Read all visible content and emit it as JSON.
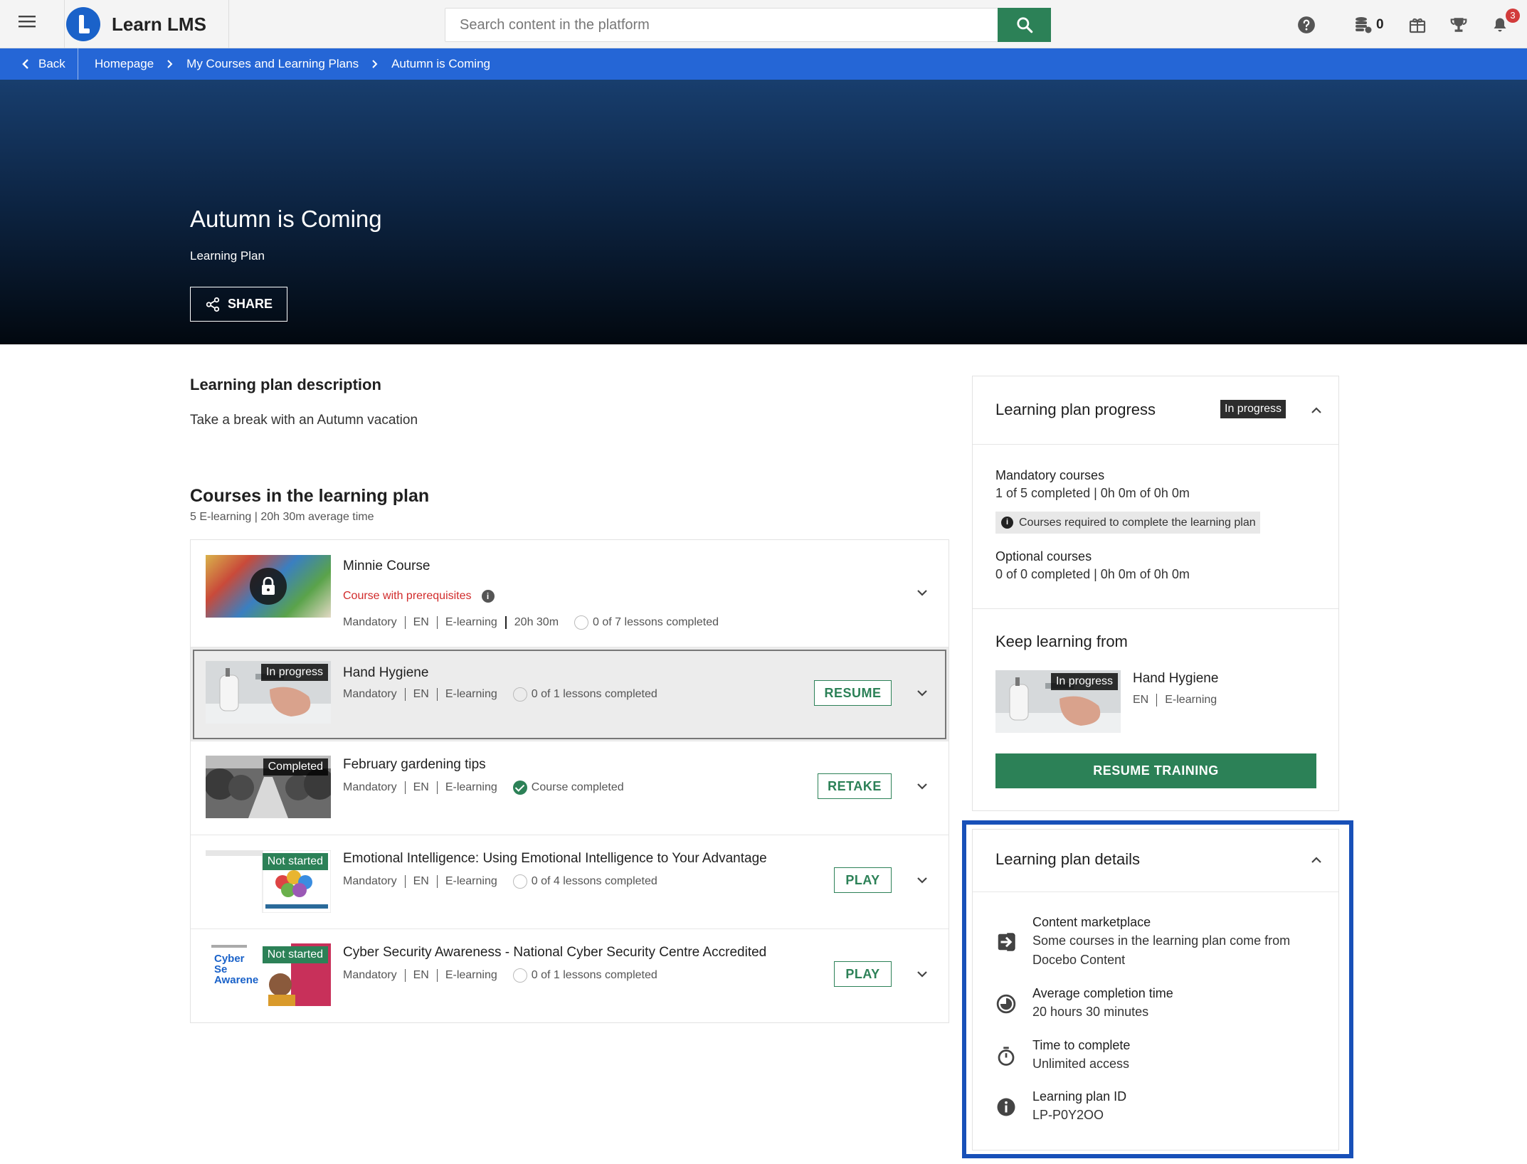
{
  "app": {
    "name": "Learn LMS",
    "search_placeholder": "Search content in the platform",
    "coins": "0",
    "notifications": "3"
  },
  "breadcrumb": {
    "back": "Back",
    "items": [
      "Homepage",
      "My Courses and Learning Plans",
      "Autumn is Coming"
    ]
  },
  "hero": {
    "title": "Autumn is Coming",
    "subtitle": "Learning Plan",
    "share": "SHARE"
  },
  "description": {
    "title": "Learning plan description",
    "text": "Take a break with an Autumn vacation"
  },
  "courses": {
    "title": "Courses in the learning plan",
    "subtitle": "5 E-learning | 20h 30m average time",
    "items": [
      {
        "name": "Minnie Course",
        "prereq": "Course with prerequisites",
        "type": "Mandatory",
        "lang": "EN",
        "format": "E-learning",
        "duration": "20h 30m",
        "progress": "0 of 7 lessons completed"
      },
      {
        "name": "Hand Hygiene",
        "badge": "In progress",
        "type": "Mandatory",
        "lang": "EN",
        "format": "E-learning",
        "progress": "0 of 1 lessons completed",
        "action": "RESUME"
      },
      {
        "name": "February gardening tips",
        "badge": "Completed",
        "type": "Mandatory",
        "lang": "EN",
        "format": "E-learning",
        "progress": "Course completed",
        "action": "RETAKE"
      },
      {
        "name": "Emotional Intelligence: Using Emotional Intelligence to Your Advantage",
        "badge": "Not started",
        "type": "Mandatory",
        "lang": "EN",
        "format": "E-learning",
        "progress": "0 of 4 lessons completed",
        "action": "PLAY"
      },
      {
        "name": "Cyber Security Awareness - National Cyber Security Centre Accredited",
        "badge": "Not started",
        "thumb_text": "Cyber Se Awarene",
        "type": "Mandatory",
        "lang": "EN",
        "format": "E-learning",
        "progress": "0 of 1 lessons completed",
        "action": "PLAY"
      }
    ]
  },
  "progress_panel": {
    "title": "Learning plan progress",
    "status": "In progress",
    "mandatory_label": "Mandatory courses",
    "mandatory_value": "1 of 5 completed | 0h 0m of 0h 0m",
    "required_note": "Courses required to complete the learning plan",
    "optional_label": "Optional courses",
    "optional_value": "0 of 0 completed | 0h 0m of 0h 0m",
    "keep_learning_title": "Keep learning from",
    "keep_course": "Hand Hygiene",
    "keep_badge": "In progress",
    "keep_lang": "EN",
    "keep_format": "E-learning",
    "resume_button": "RESUME TRAINING"
  },
  "details_panel": {
    "title": "Learning plan details",
    "items": [
      {
        "icon": "arrow-in-icon",
        "label": "Content marketplace",
        "value": "Some courses in the learning plan come from Docebo Content"
      },
      {
        "icon": "clock-icon",
        "label": "Average completion time",
        "value": "20 hours 30 minutes"
      },
      {
        "icon": "timer-icon",
        "label": "Time to complete",
        "value": "Unlimited access"
      },
      {
        "icon": "info-icon",
        "label": "Learning plan ID",
        "value": "LP-P0Y2OO"
      }
    ]
  },
  "colors": {
    "primary": "#2566d6",
    "action_green": "#2c8157",
    "prereq_red": "#d12b2b",
    "highlight_outline": "#1850b8"
  }
}
